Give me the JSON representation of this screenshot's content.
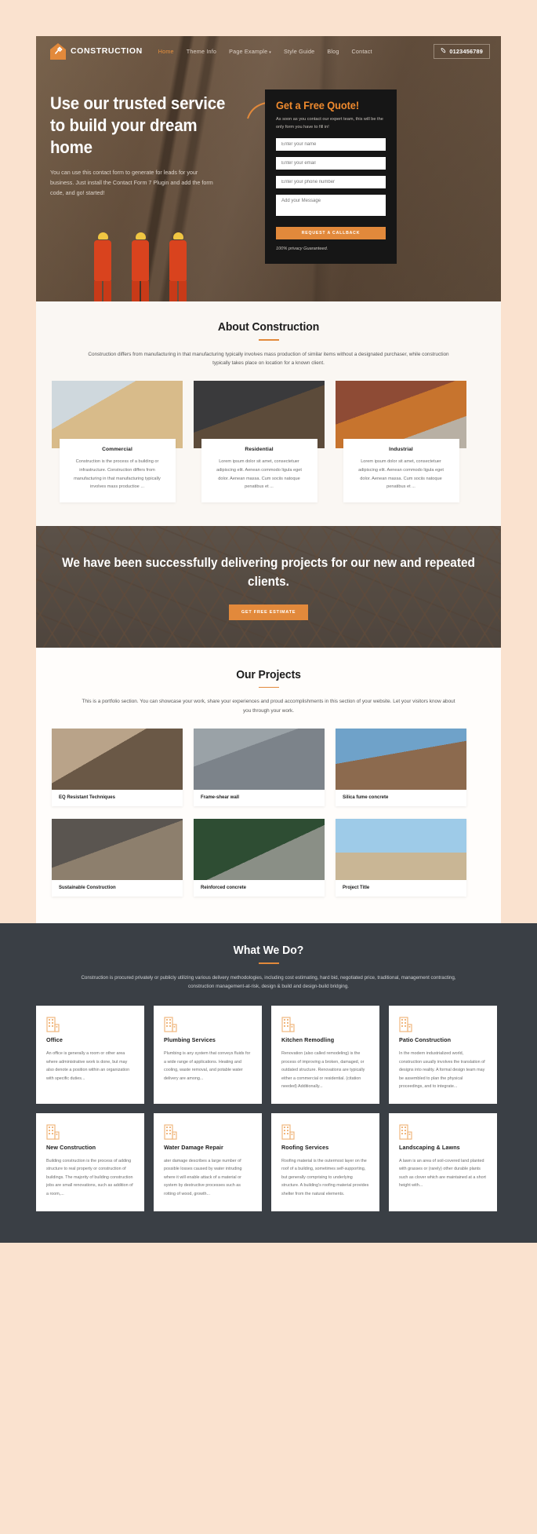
{
  "theme": {
    "accent": "#e2893b",
    "accent_bright": "#ef8a2e",
    "page_bg": "#fae2cf",
    "dark_panel": "#161616",
    "wwd_bg": "#3a3f45"
  },
  "header": {
    "brand": "CONSTRUCTION",
    "logo_icon": "house-hammer-icon",
    "nav": [
      {
        "label": "Home",
        "active": true
      },
      {
        "label": "Theme Info",
        "active": false
      },
      {
        "label": "Page Example",
        "active": false,
        "caret": "▾"
      },
      {
        "label": "Style Guide",
        "active": false
      },
      {
        "label": "Blog",
        "active": false
      },
      {
        "label": "Contact",
        "active": false
      }
    ],
    "phone": {
      "icon": "phone-icon",
      "number": "0123456789"
    }
  },
  "hero": {
    "title": "Use our trusted service to build your dream home",
    "subtitle": "You can use this contact form to generate for leads for your business. Just install the Contact Form 7 Plugin and add the form code, and go! started!",
    "arrow_icon": "curved-arrow-icon"
  },
  "quote": {
    "title": "Get a Free Quote!",
    "description": "As soon as you contact our expert team, this will be the only form you have to fill in!",
    "fields": [
      {
        "name": "name",
        "placeholder": "Enter your name",
        "value": ""
      },
      {
        "name": "email",
        "placeholder": "Enter your email",
        "value": ""
      },
      {
        "name": "phone",
        "placeholder": "Enter your phone number",
        "value": ""
      }
    ],
    "message": {
      "placeholder": "Add your Message",
      "value": ""
    },
    "submit_label": "REQUEST A CALLBACK",
    "note": "100% privacy Guaranteed."
  },
  "about": {
    "title": "About Construction",
    "description": "Construction differs from manufacturing in that manufacturing typically involves mass production of similar items without a designated purchaser, while construction typically takes place on location for a known client.",
    "cards": [
      {
        "title": "Commercial",
        "text": "Construction is the process of a building or infrastructure. Construction differs from manufacturing in that manufacturing typically involves mass productioe ..."
      },
      {
        "title": "Residential",
        "text": "Lorem ipsum dolor sit amet, consectetuer adipiscing elit. Aenean commodo ligula eget dolor. Aenean massa. Cum sociis natoque penatibus et ..."
      },
      {
        "title": "Industrial",
        "text": "Lorem ipsum dolor sit amet, consectetuer adipiscing elit. Aenean commodo ligula eget dolor. Aenean massa. Cum sociis natoque penatibus et ..."
      }
    ]
  },
  "cta": {
    "title": "We have been successfully delivering projects for our new and repeated clients.",
    "button_label": "GET FREE ESTIMATE"
  },
  "projects": {
    "title": "Our Projects",
    "description": "This is a portfolio section. You can showcase your work, share your experiences and proud accomplishments in this section of your website. Let your visitors know about you through your work.",
    "items": [
      {
        "title": "EQ Resistant Techniques"
      },
      {
        "title": "Frame-shear wall"
      },
      {
        "title": "Silica fume concrete"
      },
      {
        "title": "Sustainable Construction"
      },
      {
        "title": "Reinforced concrete"
      },
      {
        "title": "Project Title"
      }
    ]
  },
  "services": {
    "title": "What We Do?",
    "description": "Construction is procured privately or publicly utilizing various delivery methodologies, including cost estimating, hard bid, negotiated price, traditional, management contracting, construction management-at-risk, design & build and design-build bridging.",
    "icon": "building-icon",
    "items": [
      {
        "title": "Office",
        "text": "An office is generally a room or other area where administrative work is done, but may also denote a position within an organization with specific duties..."
      },
      {
        "title": "Plumbing Services",
        "text": "Plumbing is any system that conveys fluids for a wide range of applications. Heating and cooling, waste removal, and potable water delivery are among..."
      },
      {
        "title": "Kitchen Remodling",
        "text": "Renovation (also called remodeling) is the process of improving a broken, damaged, or outdated structure. Renovations are typically either a commercial or residential. (citation needed) Additionally..."
      },
      {
        "title": "Patio Construction",
        "text": "In the modern industrialized world, construction usually involves the translation of designs into reality. A formal design team may be assembled to plan the physical proceedings, and to integrate..."
      },
      {
        "title": "New Construction",
        "text": "Building construction is the process of adding structure to real property or construction of buildings. The majority of building construction jobs are small renovations, such as addition of a room,..."
      },
      {
        "title": "Water Damage Repair",
        "text": "ater damage describes a large number of possible losses caused by water intruding where it will enable attack of a material or system by destructive processes such as rotting of wood, growth..."
      },
      {
        "title": "Roofing Services",
        "text": "Roofing material is the outermost layer on the roof of a building, sometimes self-supporting, but generally comprising to underlying structure. A building's roofing material provides shelter from the natural elements."
      },
      {
        "title": "Landscaping & Lawns",
        "text": "A lawn is an area of soil-covered land planted with grasses or (rarely) other durable plants such as clover which are maintained at a short height with..."
      }
    ]
  }
}
